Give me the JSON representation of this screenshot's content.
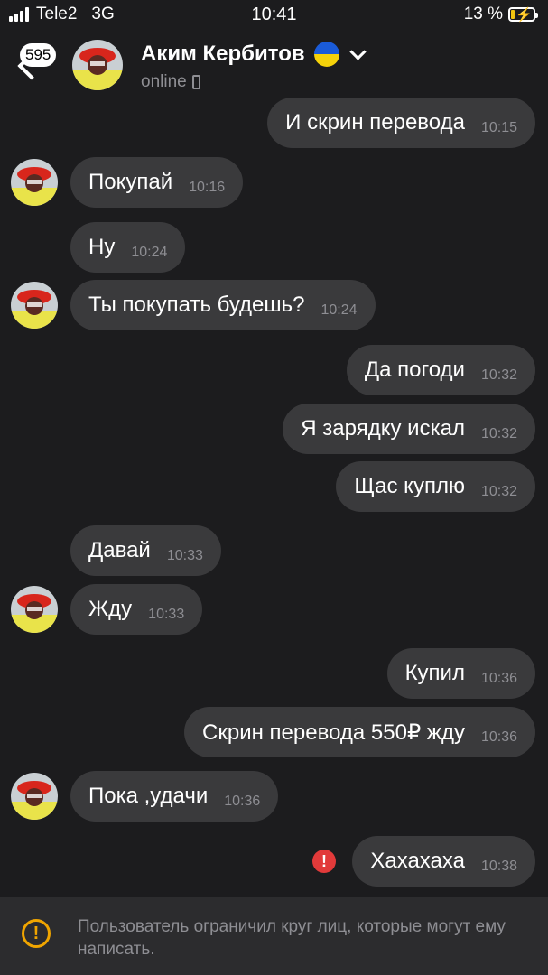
{
  "status_bar": {
    "carrier": "Tele2",
    "network": "3G",
    "time": "10:41",
    "battery_percent": "13 %",
    "battery_level": 0.13
  },
  "header": {
    "unread_count": "595",
    "contact_name": "Аким Кербитов",
    "status": "online",
    "flag_colors": {
      "top": "#1a5bd8",
      "bottom": "#f5d20a"
    }
  },
  "messages": [
    {
      "text": "И скрин перевода",
      "time": "10:15",
      "outgoing": true
    },
    {
      "text": "Покупай",
      "time": "10:16",
      "outgoing": false,
      "avatar": true
    },
    {
      "text": "Ну",
      "time": "10:24",
      "outgoing": false,
      "avatar": false
    },
    {
      "text": "Ты покупать будешь?",
      "time": "10:24",
      "outgoing": false,
      "avatar": true
    },
    {
      "text": "Да погоди",
      "time": "10:32",
      "outgoing": true
    },
    {
      "text": "Я зарядку искал",
      "time": "10:32",
      "outgoing": true
    },
    {
      "text": "Щас куплю",
      "time": "10:32",
      "outgoing": true
    },
    {
      "text": "Давай",
      "time": "10:33",
      "outgoing": false,
      "avatar": false
    },
    {
      "text": "Жду",
      "time": "10:33",
      "outgoing": false,
      "avatar": true
    },
    {
      "text": "Купил",
      "time": "10:36",
      "outgoing": true
    },
    {
      "text": "Скрин перевода 550₽ жду",
      "time": "10:36",
      "outgoing": true
    },
    {
      "text": "Пока ,удачи",
      "time": "10:36",
      "outgoing": false,
      "avatar": true
    },
    {
      "text": "Хахахаха",
      "time": "10:38",
      "outgoing": true,
      "error": true
    }
  ],
  "footer": {
    "notice": "Пользователь ограничил круг лиц, которые могут ему написать."
  },
  "colors": {
    "background": "#1c1c1e",
    "bubble": "#3a3a3c",
    "timestamp": "#8e8e93",
    "error": "#e23a3a",
    "warning": "#f0a500"
  }
}
